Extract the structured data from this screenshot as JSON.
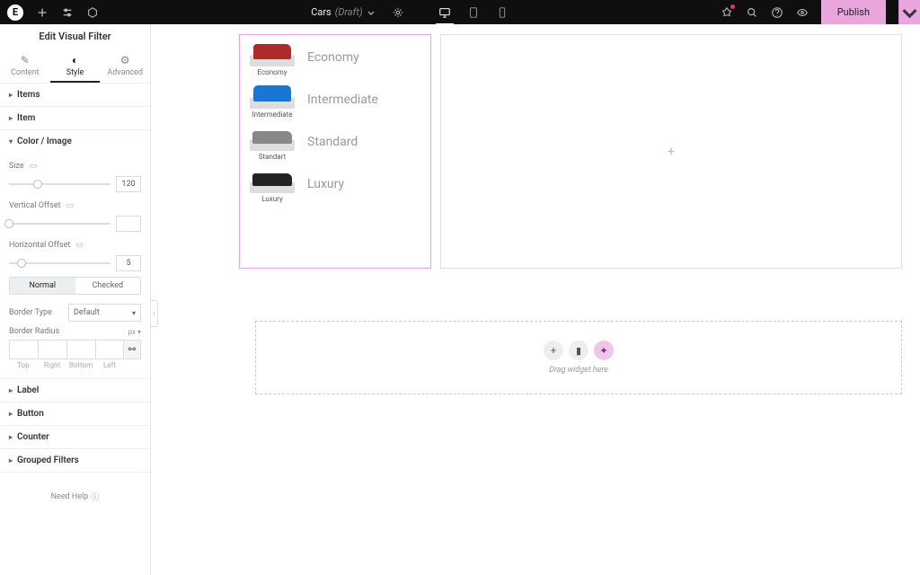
{
  "topbar": {
    "page_name": "Cars",
    "page_status": "(Draft)",
    "publish_label": "Publish"
  },
  "sidebar": {
    "title": "Edit Visual Filter",
    "tabs": {
      "content": "Content",
      "style": "Style",
      "advanced": "Advanced"
    },
    "sections": {
      "items": "Items",
      "item": "Item",
      "color_image": "Color / Image",
      "label": "Label",
      "button": "Button",
      "counter": "Counter",
      "grouped": "Grouped Filters"
    },
    "controls": {
      "size_label": "Size",
      "size_value": "120",
      "voffset_label": "Vertical Offset",
      "voffset_value": "",
      "hoffset_label": "Horizontal Offset",
      "hoffset_value": "5",
      "state_normal": "Normal",
      "state_checked": "Checked",
      "border_type_label": "Border Type",
      "border_type_value": "Default",
      "border_radius_label": "Border Radius",
      "border_radius_unit": "px",
      "corners": {
        "top": "Top",
        "right": "Right",
        "bottom": "Bottom",
        "left": "Left"
      }
    },
    "help": "Need Help"
  },
  "canvas": {
    "filters": [
      {
        "thumb_label": "Economy",
        "label": "Economy"
      },
      {
        "thumb_label": "Intermediate",
        "label": "Intermediate"
      },
      {
        "thumb_label": "Standart",
        "label": "Standard"
      },
      {
        "thumb_label": "Luxury",
        "label": "Luxury"
      }
    ],
    "dropzone_text": "Drag widget here"
  }
}
